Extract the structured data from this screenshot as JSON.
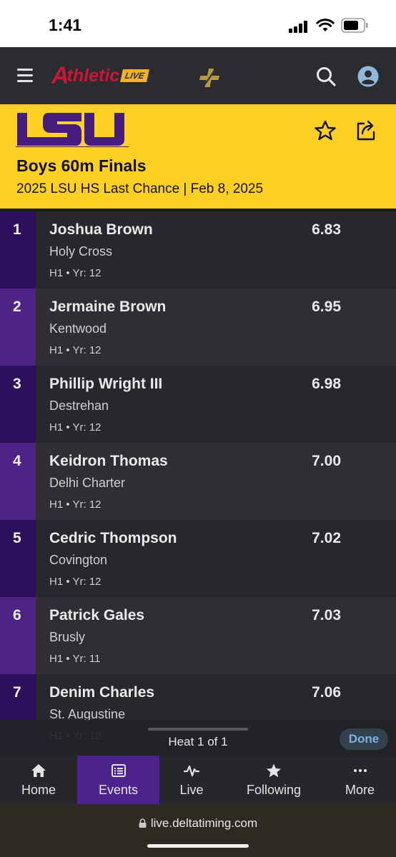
{
  "status_bar": {
    "time": "1:41"
  },
  "header": {
    "logo_text": "thletic",
    "logo_badge": "LIVE",
    "brand_color": "#c8173a"
  },
  "event": {
    "org_logo": "LSU",
    "title": "Boys 60m Finals",
    "subtitle": "2025 LSU HS Last Chance | Feb 8, 2025",
    "accent_color": "#fdd023"
  },
  "results": [
    {
      "place": "1",
      "name": "Joshua Brown",
      "team": "Holy Cross",
      "meta": "H1 • Yr: 12",
      "mark": "6.83"
    },
    {
      "place": "2",
      "name": "Jermaine Brown",
      "team": "Kentwood",
      "meta": "H1 • Yr: 12",
      "mark": "6.95"
    },
    {
      "place": "3",
      "name": "Phillip Wright III",
      "team": "Destrehan",
      "meta": "H1 • Yr: 12",
      "mark": "6.98"
    },
    {
      "place": "4",
      "name": "Keidron Thomas",
      "team": "Delhi Charter",
      "meta": "H1 • Yr: 12",
      "mark": "7.00"
    },
    {
      "place": "5",
      "name": "Cedric Thompson",
      "team": "Covington",
      "meta": "H1 • Yr: 12",
      "mark": "7.02"
    },
    {
      "place": "6",
      "name": "Patrick Gales",
      "team": "Brusly",
      "meta": "H1 • Yr: 11",
      "mark": "7.03"
    },
    {
      "place": "7",
      "name": "Denim Charles",
      "team": "St. Augustine",
      "meta": "H1 • Yr: 12",
      "mark": "7.06"
    }
  ],
  "heat_bar": {
    "label": "Heat 1 of 1",
    "done_label": "Done"
  },
  "nav": {
    "items": [
      {
        "label": "Home",
        "icon": "home-icon"
      },
      {
        "label": "Events",
        "icon": "list-icon",
        "active": true
      },
      {
        "label": "Live",
        "icon": "pulse-icon"
      },
      {
        "label": "Following",
        "icon": "star-icon"
      },
      {
        "label": "More",
        "icon": "more-icon"
      }
    ]
  },
  "browser": {
    "url": "live.deltatiming.com"
  }
}
